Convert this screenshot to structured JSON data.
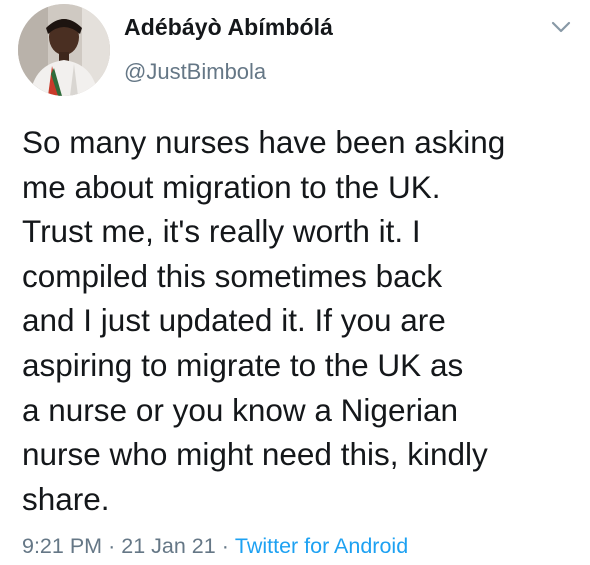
{
  "author": {
    "display_name": "Adébáyò Abímbólá",
    "handle": "@JustBimbola"
  },
  "tweet": {
    "lines": [
      "So many nurses have been asking",
      "me about migration to the UK.",
      "Trust me, it's really worth it. I",
      "compiled this sometimes back",
      "and I just updated it. If you are",
      "aspiring to migrate to the UK as",
      "a nurse or you know a Nigerian",
      "nurse who might need this, kindly",
      "share."
    ],
    "time": "9:21 PM",
    "separator": "·",
    "date": "21 Jan 21",
    "source": "Twitter for Android"
  },
  "icons": {
    "more": "chevron-down-icon",
    "avatar": "profile-photo"
  },
  "colors": {
    "text": "#14171a",
    "secondary": "#657786",
    "link": "#1da1f2"
  }
}
